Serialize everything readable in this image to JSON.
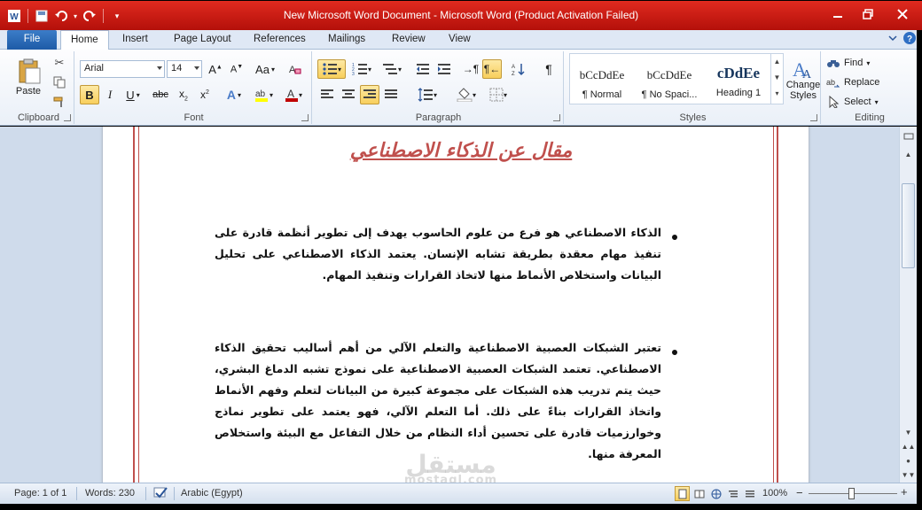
{
  "window": {
    "title": "New Microsoft Word Document  -  Microsoft Word (Product Activation Failed)"
  },
  "tabs": [
    {
      "label": "File"
    },
    {
      "label": "Home"
    },
    {
      "label": "Insert"
    },
    {
      "label": "Page Layout"
    },
    {
      "label": "References"
    },
    {
      "label": "Mailings"
    },
    {
      "label": "Review"
    },
    {
      "label": "View"
    }
  ],
  "ribbon": {
    "clipboard": {
      "label": "Clipboard",
      "paste": "Paste"
    },
    "font": {
      "label": "Font",
      "family": "Arial",
      "size": "14",
      "case_label": "Aa"
    },
    "paragraph": {
      "label": "Paragraph"
    },
    "styles": {
      "label": "Styles",
      "items": [
        {
          "sample": "bCcDdEe",
          "name": "¶ Normal"
        },
        {
          "sample": "bCcDdEe",
          "name": "¶ No Spaci..."
        },
        {
          "sample": "cDdEe",
          "name": "Heading 1"
        }
      ],
      "change_styles": "Change",
      "change_styles_2": "Styles"
    },
    "editing": {
      "label": "Editing",
      "find": "Find",
      "replace": "Replace",
      "select": "Select"
    }
  },
  "document": {
    "title": "مقال عن الذكاء الاصطناعي",
    "paragraphs": [
      "الذكاء الاصطناعي هو فرع من علوم الحاسوب يهدف إلى تطوير أنظمة قادرة على تنفيذ مهام معقدة بطريقة تشابه الإنسان. يعتمد الذكاء الاصطناعي على تحليل البيانات واستخلاص الأنماط منها لاتخاذ القرارات وتنفيذ المهام.",
      "تعتبر الشبكات العصبية الاصطناعية والتعلم الآلي من أهم أساليب تحقيق الذكاء الاصطناعي. تعتمد الشبكات العصبية الاصطناعية على نموذج تشبه الدماغ البشري، حيث يتم تدريب هذه الشبكات على مجموعة كبيرة من البيانات لتعلم وفهم الأنماط واتخاذ القرارات بناءً على ذلك. أما التعلم الآلي، فهو يعتمد على تطوير نماذج وخوارزميات قادرة على تحسين أداء النظام من خلال التفاعل مع البيئة واستخلاص المعرفة منها."
    ],
    "watermark": {
      "arabic": "مستقل",
      "latin": "mostaql.com"
    }
  },
  "status": {
    "page": "Page: 1 of 1",
    "words": "Words: 230",
    "language": "Arabic (Egypt)",
    "zoom": "100%"
  }
}
